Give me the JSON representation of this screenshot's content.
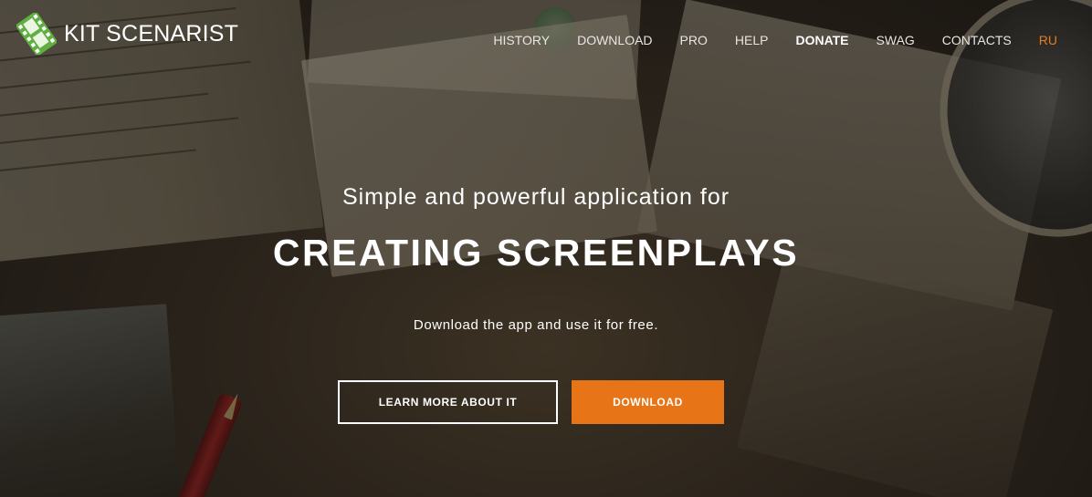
{
  "brand": {
    "name": "KIT SCENARIST",
    "logo_icon": "film-strip-logo-icon",
    "logo_color": "#5fb040"
  },
  "nav": {
    "items": [
      {
        "label": "HISTORY"
      },
      {
        "label": "DOWNLOAD"
      },
      {
        "label": "PRO"
      },
      {
        "label": "HELP"
      },
      {
        "label": "DONATE"
      },
      {
        "label": "SWAG"
      },
      {
        "label": "CONTACTS"
      },
      {
        "label": "RU"
      }
    ],
    "active_color": "#e87a20"
  },
  "hero": {
    "subtitle": "Simple and powerful application for",
    "title": "CREATING SCREENPLAYS",
    "description": "Download the app and use it for free.",
    "learn_more_label": "LEARN MORE ABOUT IT",
    "download_label": "DOWNLOAD",
    "accent_color": "#e87418"
  }
}
